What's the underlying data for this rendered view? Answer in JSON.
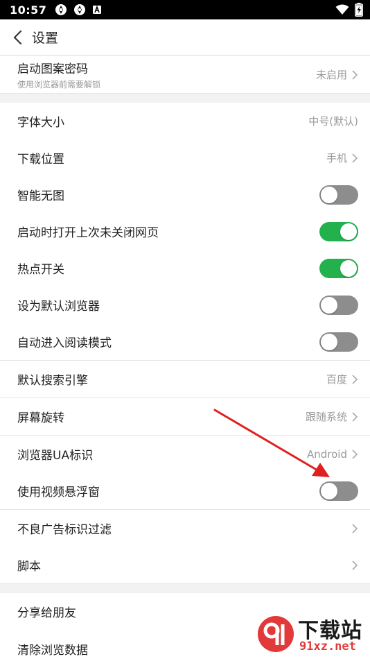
{
  "status": {
    "time": "10:57"
  },
  "header": {
    "title": "设置"
  },
  "rows": {
    "pattern": {
      "label": "启动图案密码",
      "sub": "使用浏览器前需要解锁",
      "value": "未启用"
    },
    "font": {
      "label": "字体大小",
      "value": "中号(默认)"
    },
    "download": {
      "label": "下载位置",
      "value": "手机"
    },
    "noimage": {
      "label": "智能无图",
      "state": "off"
    },
    "restore": {
      "label": "启动时打开上次未关闭网页",
      "state": "on"
    },
    "hotspot": {
      "label": "热点开关",
      "state": "on"
    },
    "default_browser": {
      "label": "设为默认浏览器",
      "state": "off"
    },
    "reader": {
      "label": "自动进入阅读模式",
      "state": "off"
    },
    "search": {
      "label": "默认搜索引擎",
      "value": "百度"
    },
    "rotate": {
      "label": "屏幕旋转",
      "value": "跟随系统"
    },
    "ua": {
      "label": "浏览器UA标识",
      "value": "Android"
    },
    "float_video": {
      "label": "使用视频悬浮窗",
      "state": "off"
    },
    "ad_filter": {
      "label": "不良广告标识过滤"
    },
    "script": {
      "label": "脚本"
    },
    "share": {
      "label": "分享给朋友"
    },
    "clear": {
      "label": "清除浏览数据"
    }
  },
  "colors": {
    "toggle_on": "#23b14d",
    "toggle_off": "#8d8d8d",
    "annotation_arrow": "#e02020"
  },
  "watermark": {
    "top": "下载站",
    "bottom": "91xz.net"
  }
}
